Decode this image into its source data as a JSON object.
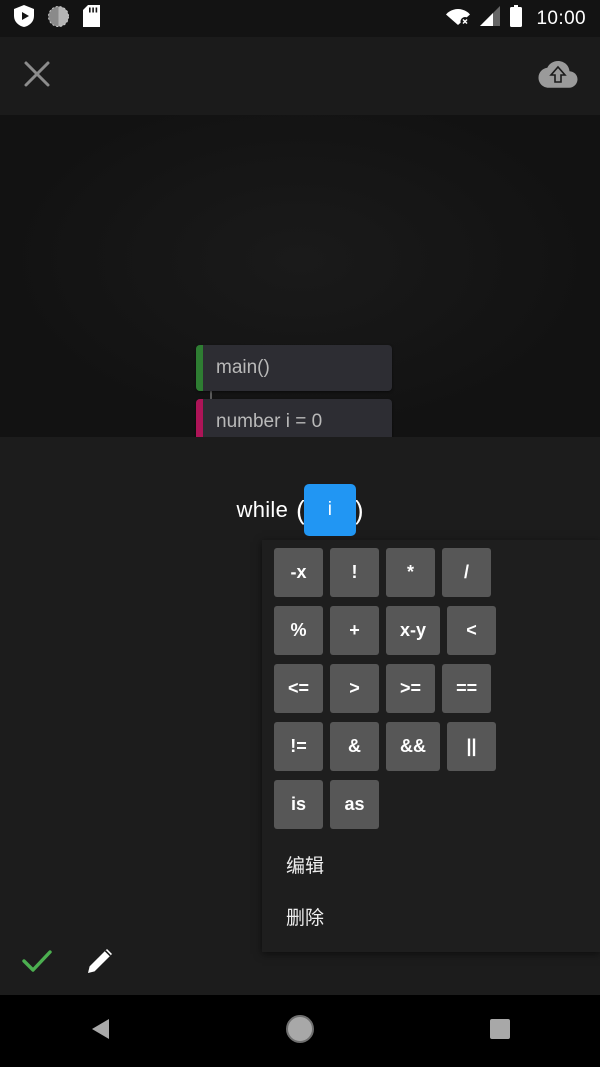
{
  "status_bar": {
    "icons_left": [
      "shield-play-icon",
      "sync-circle-icon",
      "sd-card-icon"
    ],
    "icons_right": [
      "wifi-off-icon",
      "cellular-signal-icon",
      "battery-full-icon"
    ],
    "clock": "10:00"
  },
  "toolbar": {
    "close_label": "close-icon",
    "upload_label": "cloud-upload-icon"
  },
  "canvas": {
    "blocks": [
      {
        "label": "main()",
        "accent": "#2E7D32"
      },
      {
        "label": "number i = 0",
        "accent": "#AD1457"
      }
    ]
  },
  "expression": {
    "keyword": "while",
    "open_paren": "(",
    "close_paren": ")",
    "selected_token": "i",
    "selection_color": "#2196F3"
  },
  "popup": {
    "operator_rows": [
      [
        "-x",
        "!",
        "*",
        "/"
      ],
      [
        "%",
        "+",
        "x-y",
        "<"
      ],
      [
        "<=",
        ">",
        ">=",
        "=="
      ],
      [
        "!=",
        "&",
        "&&",
        "||"
      ],
      [
        "is",
        "as"
      ]
    ],
    "menu_items": [
      "编辑",
      "删除"
    ],
    "button_color": "#575757"
  },
  "action_bar": {
    "confirm_label": "check-icon",
    "confirm_color": "#4CAF50",
    "edit_label": "pencil-icon"
  },
  "navbar": {
    "back_label": "back-triangle-icon",
    "home_label": "home-circle-icon",
    "recents_label": "recents-square-icon"
  }
}
